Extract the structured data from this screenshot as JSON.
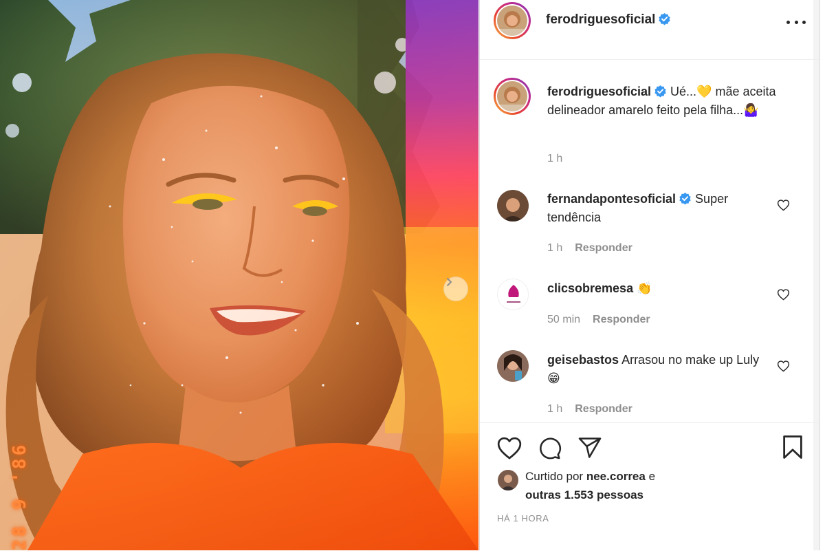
{
  "post": {
    "author": "ferodriguesoficial",
    "caption": "Ué...💛 mãe aceita delineador amarelo feito pela filha...🤷‍♀️",
    "caption_time": "1 h",
    "photo_date_stamp": "28 9 '86"
  },
  "comments": [
    {
      "user": "fernandapontesoficial",
      "verified": true,
      "text": "Super tendência",
      "time": "1 h",
      "reply_label": "Responder"
    },
    {
      "user": "clicsobremesa",
      "verified": false,
      "text": "👏",
      "time": "50 min",
      "reply_label": "Responder"
    },
    {
      "user": "geisebastos",
      "verified": false,
      "text": "Arrasou no make up Luly 😁",
      "time": "1 h",
      "reply_label": "Responder"
    }
  ],
  "likes": {
    "prefix": "Curtido por",
    "user": "nee.correa",
    "middle": "e",
    "others": "outras 1.553 pessoas"
  },
  "time_ago": "HÁ 1 HORA",
  "icons": {
    "verified": "verified-badge-icon",
    "more": "more-options-icon",
    "next": "chevron-right-icon",
    "like": "heart-icon",
    "comment": "comment-icon",
    "share": "share-icon",
    "save": "bookmark-icon"
  },
  "colors": {
    "verified_blue": "#3897f0",
    "text": "#262626",
    "muted": "#8e8e8e",
    "divider": "#efefef"
  }
}
